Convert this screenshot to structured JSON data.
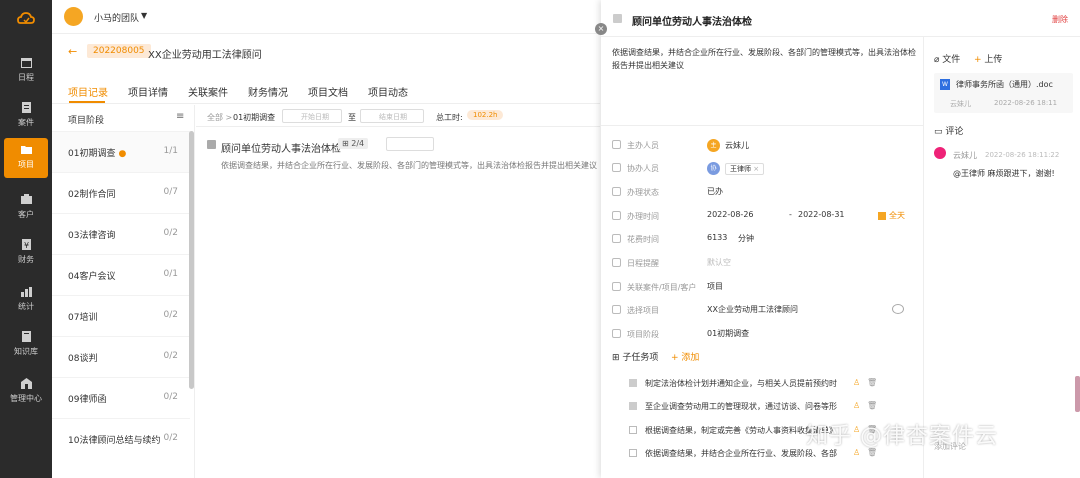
{
  "sidebar": {
    "items": [
      {
        "label": "日程",
        "icon": "calendar-icon"
      },
      {
        "label": "案件",
        "icon": "case-icon"
      },
      {
        "label": "项目",
        "icon": "folder-icon"
      },
      {
        "label": "客户",
        "icon": "customer-icon"
      },
      {
        "label": "财务",
        "icon": "finance-icon"
      },
      {
        "label": "统计",
        "icon": "stats-icon"
      },
      {
        "label": "知识库",
        "icon": "book-icon"
      },
      {
        "label": "管理中心",
        "icon": "building-icon"
      }
    ],
    "active": "项目"
  },
  "topbar": {
    "team_name": "小马的团队",
    "caret": "▼"
  },
  "project": {
    "code": "202208005",
    "title": "XX企业劳动用工法律顾问"
  },
  "tabs": [
    "项目记录",
    "项目详情",
    "关联案件",
    "财务情况",
    "项目文档",
    "项目动态"
  ],
  "stages": {
    "header": "项目阶段",
    "items": [
      {
        "name": "01初期调查",
        "count": "1/1",
        "dot": "●"
      },
      {
        "name": "02制作合同",
        "count": "0/7"
      },
      {
        "name": "03法律咨询",
        "count": "0/2"
      },
      {
        "name": "04客户会议",
        "count": "0/1"
      },
      {
        "name": "07培训",
        "count": "0/2"
      },
      {
        "name": "08谈判",
        "count": "0/2"
      },
      {
        "name": "09律师函",
        "count": "0/2"
      },
      {
        "name": "10法律顾问总结与续约",
        "count": "0/2"
      }
    ]
  },
  "filter": {
    "all": "全部",
    "sep": ">",
    "stage": "01初期调查",
    "start_placeholder": "开始日期",
    "to": "至",
    "end_placeholder": "结束日期",
    "work_label": "总工时:",
    "work_value": "102.2h"
  },
  "task": {
    "title": "顾问单位劳动人事法治体检",
    "subtask_count": "2/4",
    "description": "依据调查结果，并结合企业所在行业、发展阶段、各部门的管理模式等，出具法治体检报告并提出相关建议"
  },
  "drawer": {
    "title": "顾问单位劳动人事法治体检",
    "delete": "删除",
    "description": "依据调查结果，并结合企业所在行业、发展阶段、各部门的管理模式等，出具法治体检报告并提出相关建议",
    "fields": {
      "owner_label": "主办人员",
      "owner_avatar": "主",
      "owner": "云妹儿",
      "co_label": "协办人员",
      "co_avatar": "协",
      "co": "王律师",
      "co_x": "×",
      "status_label": "办理状态",
      "status": "已办",
      "time_label": "办理时间",
      "start": "2022-08-26",
      "dash": "-",
      "end": "2022-08-31",
      "allday": "全天",
      "spent_label": "花费时间",
      "spent": "6133",
      "spent_unit": "分钟",
      "reminder_label": "日程提醒",
      "reminder": "默认空",
      "link_label": "关联案件/项目/客户",
      "link": "项目",
      "select_label": "选择项目",
      "select": "XX企业劳动用工法律顾问",
      "stage_label": "项目阶段",
      "stage": "01初期调查"
    },
    "subtasks": {
      "header": "子任务项",
      "add": "+ 添加",
      "items": [
        {
          "text": "制定法治体检计划并通知企业，与相关人员提前预约时",
          "done": true
        },
        {
          "text": "至企业调查劳动用工的管理现状，通过访谈、问卷等形",
          "done": true
        },
        {
          "text": "根据调查结果，制定或完善《劳动人事资料收集清单》",
          "done": false
        },
        {
          "text": "依据调查结果，并结合企业所在行业、发展阶段、各部",
          "done": false
        }
      ]
    },
    "files": {
      "label": "文件",
      "upload": "上传",
      "items": [
        {
          "name": "律师事务所函（通用）.doc",
          "author": "云妹儿",
          "time": "2022-08-26 18:11"
        }
      ]
    },
    "comments": {
      "label": "评论",
      "items": [
        {
          "author": "云妹儿",
          "time": "2022-08-26 18:11:22",
          "text": "@王律师 麻烦跟进下，谢谢!"
        }
      ],
      "input_hint": "添加评论"
    }
  },
  "watermark": "知乎 @律杏案件云",
  "colors": {
    "accent": "#f08c00",
    "sidebar": "#2b2b2b",
    "danger": "#e03c3c"
  }
}
